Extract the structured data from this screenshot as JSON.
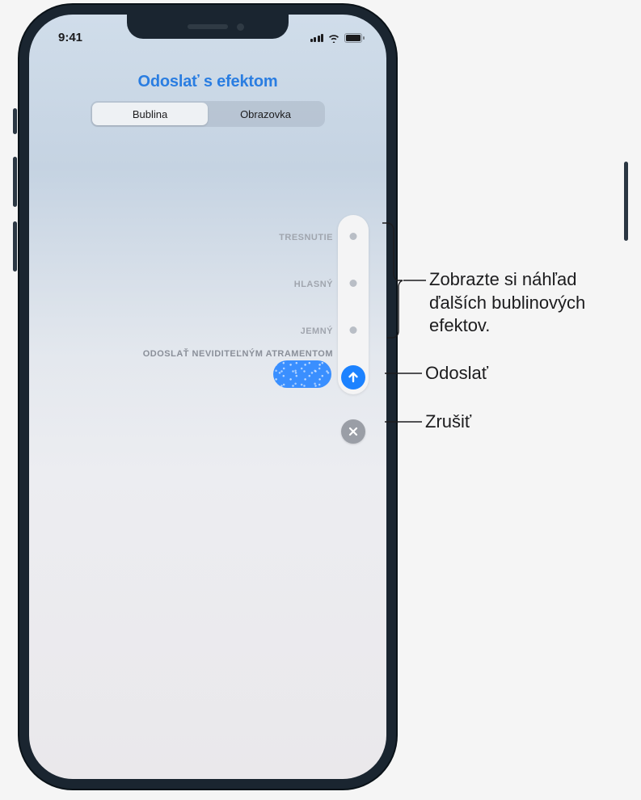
{
  "status_bar": {
    "time": "9:41"
  },
  "header": {
    "title": "Odoslať s efektom"
  },
  "tabs": {
    "bubble": "Bublina",
    "screen": "Obrazovka"
  },
  "effects": {
    "slam": "TRESNUTIE",
    "loud": "HLASNÝ",
    "gentle": "JEMNÝ",
    "invisible_ink": "ODOSLAŤ NEVIDITEĽNÝM ATRAMENTOM"
  },
  "callouts": {
    "preview": "Zobrazte si náhľad ďalších bublinových efektov.",
    "send": "Odoslať",
    "cancel": "Zrušiť"
  }
}
